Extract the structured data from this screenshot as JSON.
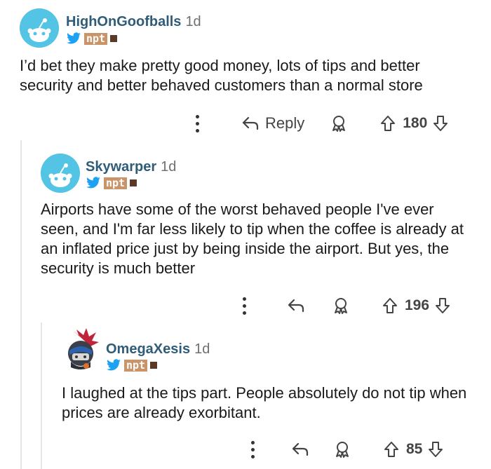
{
  "comments": [
    {
      "username": "HighOnGoofballs",
      "age": "1d",
      "flair_text": "npt",
      "text": "I’d bet they make pretty good money, lots of tips and better security and better behaved customers than a normal store",
      "reply_label": "Reply",
      "votes": "180"
    },
    {
      "username": "Skywarper",
      "age": "1d",
      "flair_text": "npt",
      "text": "Airports have some of the worst behaved people I've ever seen, and I'm far less likely to tip when the coffee is already at an inflated price just by being inside the airport. But yes, the security is much better",
      "votes": "196"
    },
    {
      "username": "OmegaXesis",
      "age": "1d",
      "flair_text": "npt",
      "text": "I laughed at the tips part. People absolutely do not tip when prices are already exorbitant.",
      "votes": "85"
    }
  ],
  "colors": {
    "username": "#2f5c79",
    "avatar_bg": "#54c4e4",
    "twitter_blue": "#1da1f2",
    "thread_line": "#e6e6e6"
  }
}
